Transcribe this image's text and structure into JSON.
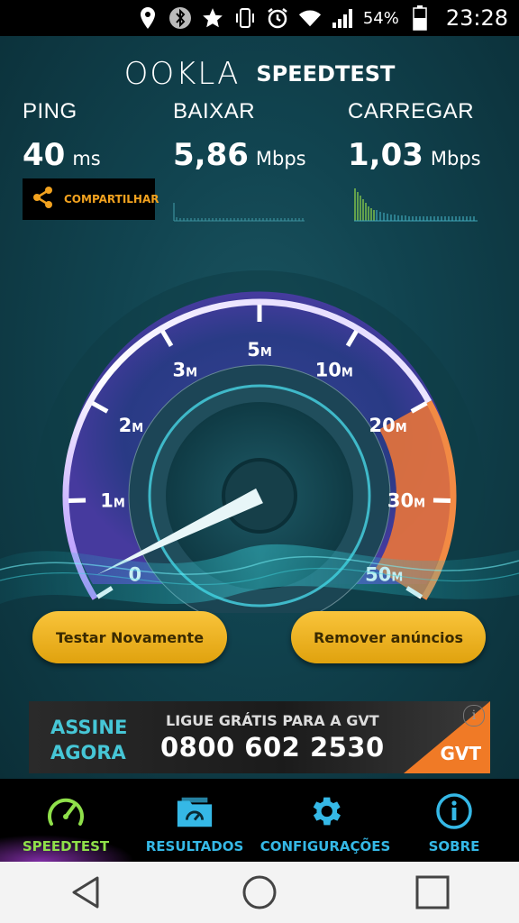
{
  "status_bar": {
    "icons": [
      "location-icon",
      "bluetooth-icon",
      "star-icon",
      "vibrate-icon",
      "alarm-icon",
      "wifi-icon",
      "signal-icon",
      "battery-icon"
    ],
    "battery": "54%",
    "time": "23:28"
  },
  "logo": {
    "ookla": "OOKLA",
    "speedtest": "SPEEDTEST"
  },
  "metrics": {
    "ping": {
      "label": "PING",
      "value": "40",
      "unit": "ms"
    },
    "download": {
      "label": "BAIXAR",
      "value": "5,86",
      "unit": "Mbps"
    },
    "upload": {
      "label": "CARREGAR",
      "value": "1,03",
      "unit": "Mbps"
    }
  },
  "share_label": "COMPARTILHAR",
  "gauge": {
    "labels": [
      "0",
      "1M",
      "2M",
      "3M",
      "5M",
      "10M",
      "20M",
      "30M",
      "50M"
    ],
    "needle_value_mbps": 0.2
  },
  "buttons": {
    "retest": "Testar Novamente",
    "remove_ads": "Remover anúncios"
  },
  "ad": {
    "headline_1": "ASSINE",
    "headline_2": "AGORA",
    "tagline": "LIGUE GRÁTIS PARA A GVT",
    "phone": "0800 602 2530",
    "brand": "GVT"
  },
  "tabs": [
    {
      "label": "SPEEDTEST",
      "icon": "speedometer-icon",
      "active": true
    },
    {
      "label": "RESULTADOS",
      "icon": "results-folder-icon",
      "active": false
    },
    {
      "label": "CONFIGURAÇÕES",
      "icon": "gear-icon",
      "active": false
    },
    {
      "label": "SOBRE",
      "icon": "info-icon",
      "active": false
    }
  ],
  "colors": {
    "accent_gold": "#f2b523",
    "tab_blue": "#35b8e6",
    "tab_active_green": "#8fe04a",
    "gauge_purple": "#7a4fd6",
    "gauge_orange": "#e8743a",
    "wave_cyan": "#3fd6e0"
  }
}
